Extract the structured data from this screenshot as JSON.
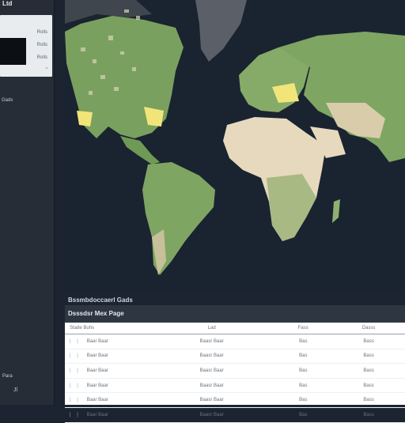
{
  "sidebar": {
    "title": "Ltd",
    "options": [
      "Rolls",
      "Rolls",
      "Rolls"
    ],
    "caret": "⌄",
    "section_label": "Gads",
    "bottom_label_1": "Para",
    "bottom_label_2": "Jl"
  },
  "map": {
    "ocean_color": "#1a2330",
    "land_color": "#7fa563",
    "desert_color": "#e8dcc2",
    "highlight_color": "#f1e57a"
  },
  "section": {
    "title": "Bssmbdoccaerl Gads"
  },
  "table": {
    "header": "Dsssdsr Mex Page",
    "columns": [
      "Stade Buhs",
      "Lad",
      "Fass",
      "Dasss"
    ],
    "rows": [
      {
        "checks": "|  |",
        "c1": "Baar Baar",
        "c2": "Baasr Baar",
        "c3": "Bas",
        "c4": "Bass"
      },
      {
        "checks": "|  |",
        "c1": "Baar Baar",
        "c2": "Baasr Baar",
        "c3": "Bas",
        "c4": "Bass"
      },
      {
        "checks": "|  |",
        "c1": "Baar Baar",
        "c2": "Baasr Baar",
        "c3": "Bas",
        "c4": "Bass"
      },
      {
        "checks": "|  |",
        "c1": "Baar Baar",
        "c2": "Baasr Baar",
        "c3": "Bas",
        "c4": "Bass"
      },
      {
        "checks": "|  |",
        "c1": "Baar Baar",
        "c2": "Baasr Baar",
        "c3": "Bas",
        "c4": "Bass"
      },
      {
        "checks": "|  |",
        "c1": "Baar Baar",
        "c2": "Baasr Baar",
        "c3": "Bas",
        "c4": "Bass"
      }
    ]
  }
}
